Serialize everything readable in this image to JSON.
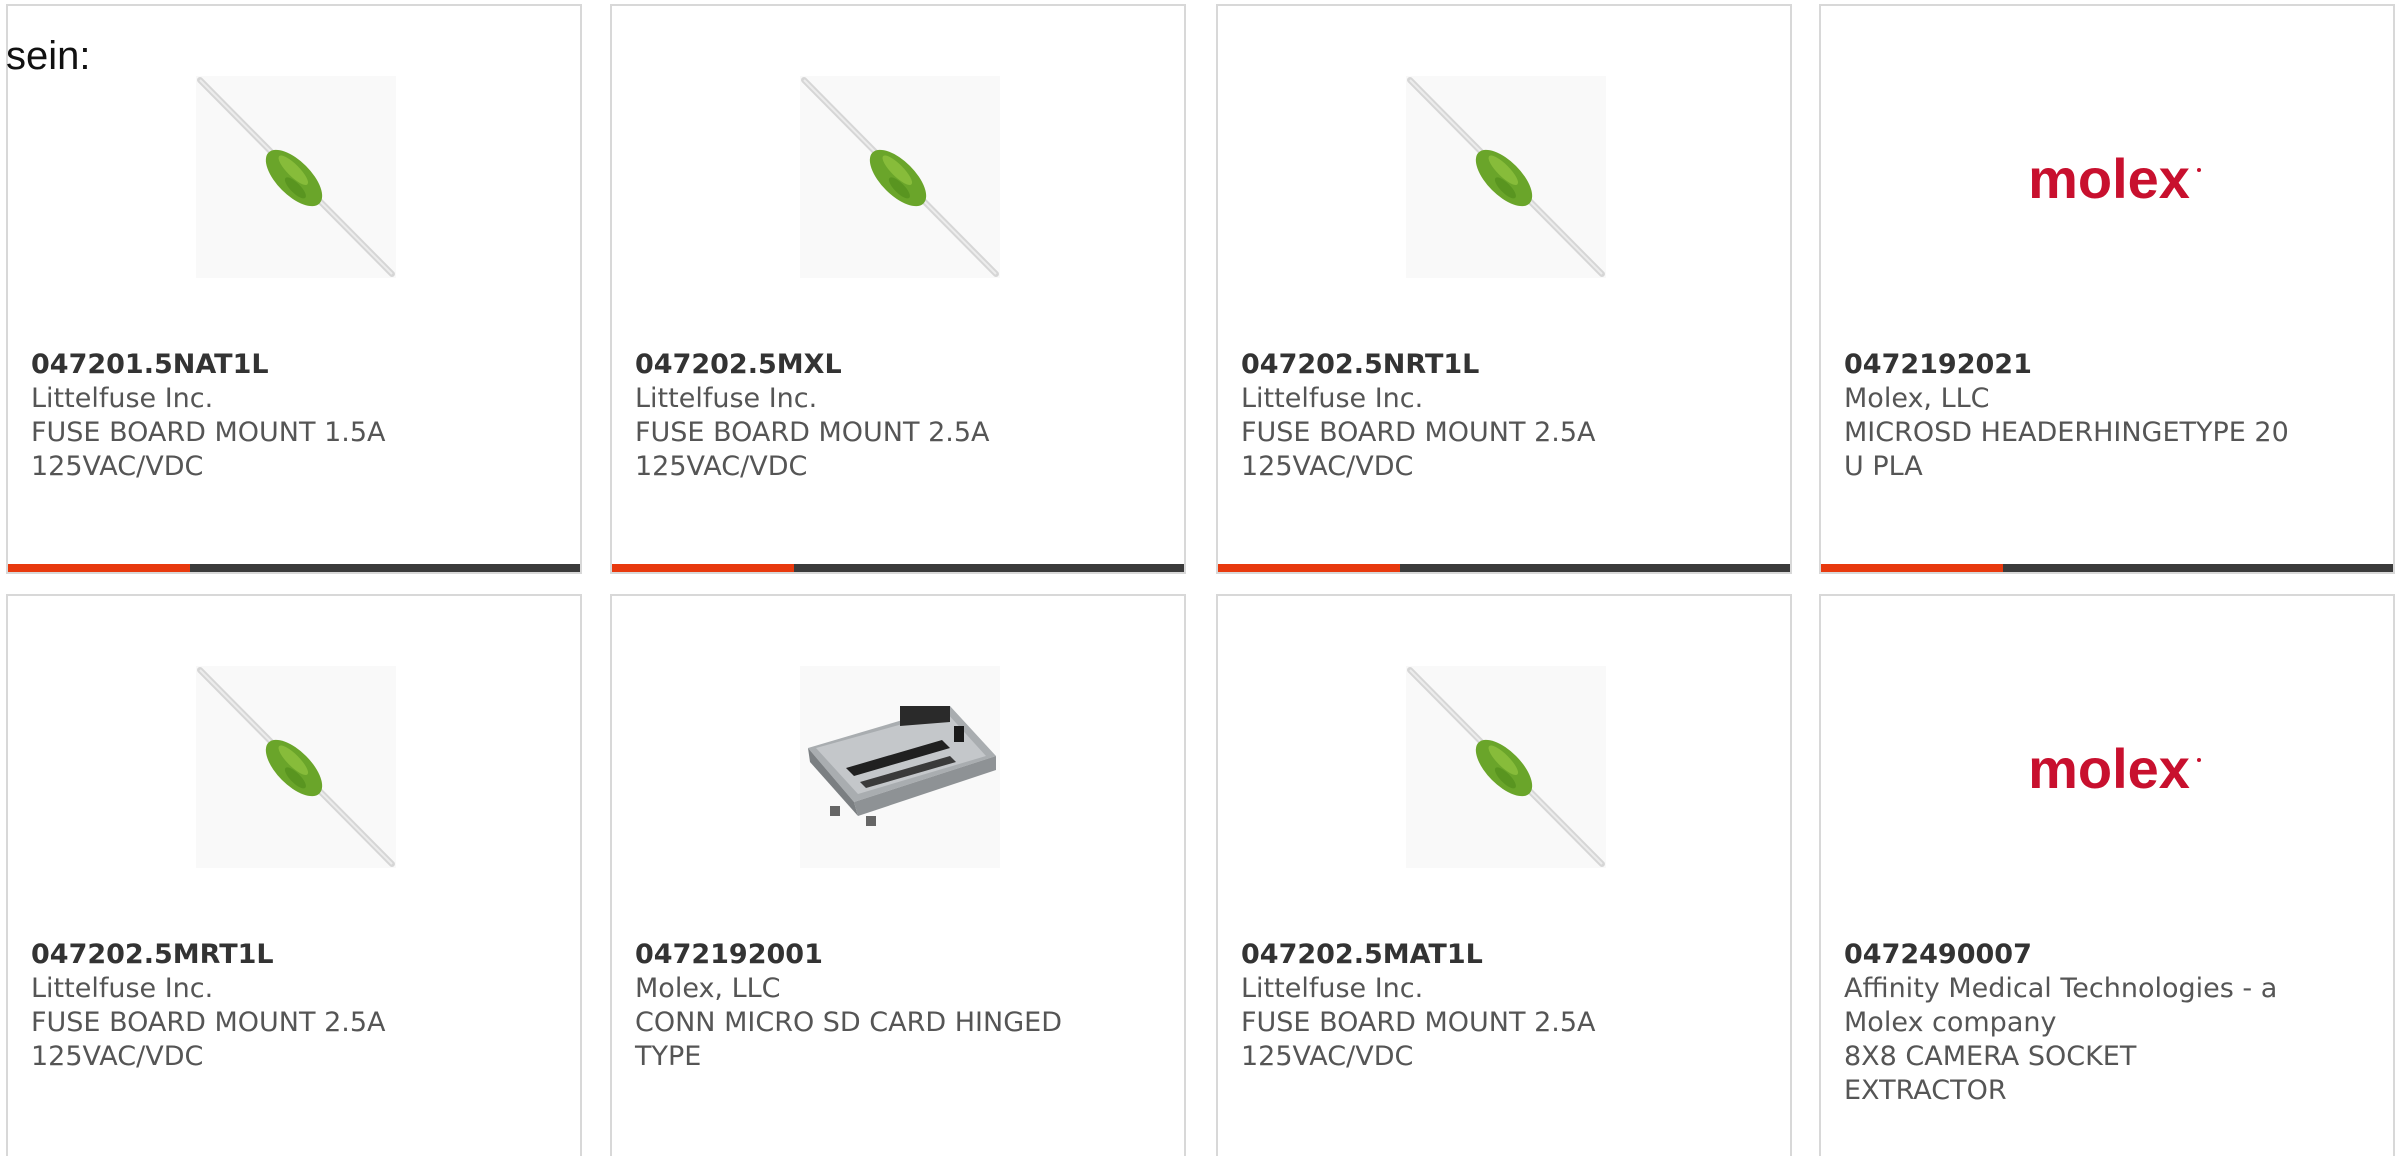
{
  "intro_text": "sein:",
  "colors": {
    "accent": "#e8390e",
    "bar_dark": "#3b3b3b",
    "fuse_body": "#6aa52a",
    "molex_red": "#c8102e"
  },
  "products": [
    {
      "part_number": "047201.5NAT1L",
      "manufacturer": "Littelfuse Inc.",
      "desc_line1": "FUSE BOARD MOUNT 1.5A",
      "desc_line2": "125VAC/VDC",
      "image": "axial-fuse"
    },
    {
      "part_number": "047202.5MXL",
      "manufacturer": "Littelfuse Inc.",
      "desc_line1": "FUSE BOARD MOUNT 2.5A",
      "desc_line2": "125VAC/VDC",
      "image": "axial-fuse"
    },
    {
      "part_number": "047202.5NRT1L",
      "manufacturer": "Littelfuse Inc.",
      "desc_line1": "FUSE BOARD MOUNT 2.5A",
      "desc_line2": "125VAC/VDC",
      "image": "axial-fuse"
    },
    {
      "part_number": "0472192021",
      "manufacturer": "Molex, LLC",
      "desc_line1": "MICROSD HEADERHINGETYPE 20",
      "desc_line2": "U PLA",
      "image": "molex-logo",
      "logo_text": "molex"
    },
    {
      "part_number": "047202.5MRT1L",
      "manufacturer": "Littelfuse Inc.",
      "desc_line1": "FUSE BOARD MOUNT 2.5A",
      "desc_line2": "125VAC/VDC",
      "image": "axial-fuse"
    },
    {
      "part_number": "0472192001",
      "manufacturer": "Molex, LLC",
      "desc_line1": "CONN MICRO SD CARD HINGED",
      "desc_line2": "TYPE",
      "image": "sd-card-connector"
    },
    {
      "part_number": "047202.5MAT1L",
      "manufacturer": "Littelfuse Inc.",
      "desc_line1": "FUSE BOARD MOUNT 2.5A",
      "desc_line2": "125VAC/VDC",
      "image": "axial-fuse"
    },
    {
      "part_number": "0472490007",
      "manufacturer": "Affinity Medical Technologies - a",
      "manufacturer_line2": "Molex company",
      "desc_line1": "8X8 CAMERA SOCKET",
      "desc_line2": "EXTRACTOR",
      "image": "molex-logo",
      "logo_text": "molex"
    }
  ]
}
